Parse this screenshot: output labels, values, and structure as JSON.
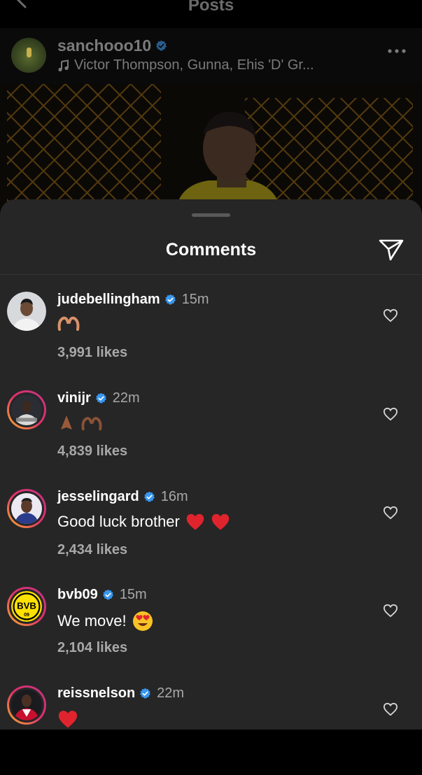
{
  "header": {
    "title": "Posts"
  },
  "post": {
    "username": "sanchooo10",
    "music": "Victor Thompson, Gunna, Ehis 'D' Gr..."
  },
  "comments_sheet": {
    "title": "Comments",
    "comments": [
      {
        "username": "judebellingham",
        "time": "15m",
        "text": "",
        "emojis": [
          "heart-hands-emoji"
        ],
        "likes": "3,991 likes"
      },
      {
        "username": "vinijr",
        "time": "22m",
        "text": "",
        "emojis": [
          "folded-hands-emoji",
          "heart-hands-emoji"
        ],
        "likes": "4,839 likes"
      },
      {
        "username": "jesselingard",
        "time": "16m",
        "text": "Good luck brother",
        "emojis": [
          "red-heart-emoji",
          "red-heart-emoji"
        ],
        "likes": "2,434 likes"
      },
      {
        "username": "bvb09",
        "time": "15m",
        "text": "We move!",
        "emojis": [
          "heart-eyes-emoji"
        ],
        "likes": "2,104 likes"
      },
      {
        "username": "reissnelson",
        "time": "22m",
        "text": "",
        "emojis": [
          "red-heart-emoji"
        ],
        "likes": ""
      }
    ]
  },
  "colors": {
    "sheet_bg": "#262626",
    "verified": "#3897f0",
    "secondary_text": "#a8a8a8",
    "heart_red": "#e0242e"
  },
  "bvb_badge": {
    "top": "BVB",
    "bottom": "09"
  }
}
